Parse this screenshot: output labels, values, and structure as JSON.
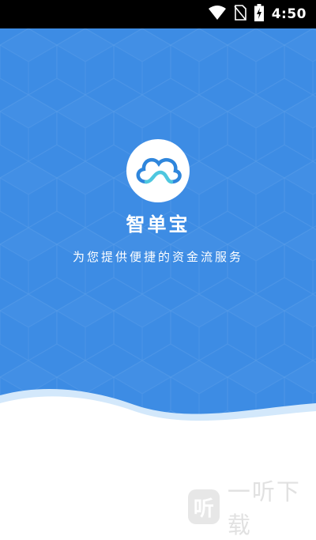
{
  "status_bar": {
    "time": "4:50",
    "icons": [
      "wifi-icon",
      "no-sim-icon",
      "battery-charging-icon"
    ]
  },
  "splash": {
    "logo_icon": "cloud-icon",
    "app_name": "智单宝",
    "slogan": "为您提供便捷的资金流服务"
  },
  "watermark": {
    "icon_char": "听",
    "text": "一听下载"
  },
  "colors": {
    "primary_blue": "#3d8ce4",
    "wave_light": "#d3e8fb",
    "logo_ring": "#2f86dc",
    "logo_accent": "#4ec7df"
  }
}
